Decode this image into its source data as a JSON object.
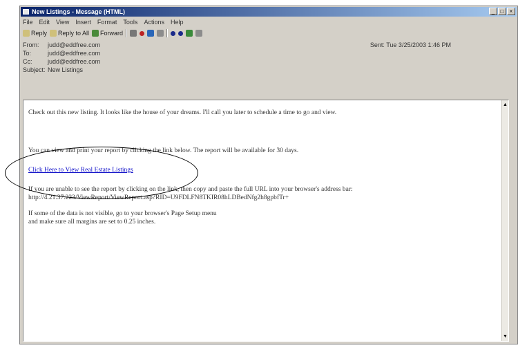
{
  "window": {
    "title": "New Listings - Message (HTML)",
    "controls": {
      "minimize": "_",
      "restore": "□",
      "close": "×"
    }
  },
  "menu": [
    "File",
    "Edit",
    "View",
    "Insert",
    "Format",
    "Tools",
    "Actions",
    "Help"
  ],
  "toolbar": {
    "reply": "Reply",
    "reply_all": "Reply to All",
    "forward": "Forward"
  },
  "headers": {
    "from_label": "From:",
    "from_value": "judd@eddfree.com",
    "to_label": "To:",
    "to_value": "judd@eddfree.com",
    "cc_label": "Cc:",
    "cc_value": "judd@eddfree.com",
    "subject_label": "Subject:",
    "subject_value": "New Listings",
    "sent": "Sent: Tue 3/25/2003 1:46 PM"
  },
  "message": {
    "intro": "Check out this new listing. It looks like the house of your dreams. I'll call you later to schedule a time to go and view.",
    "report_note": "You can view and print your report by clicking the link below. The report will be available for 30 days.",
    "link_text": "Click Here to View Real Estate Listings",
    "fallback_line1": "If you are unable to see the report by clicking on the link, then copy and paste the full URL into your browser's address bar:",
    "fallback_url": "http://4.21.37.223/ViewReport/ViewReport.asp?RID=U9FDLFN8TKIR08hLDBedNfg2h8gpbfTr+",
    "tip_line1": "If some of the data is not visible, go to your browser's Page Setup menu",
    "tip_line2": "and make sure all margins are set to 0.25 inches."
  }
}
